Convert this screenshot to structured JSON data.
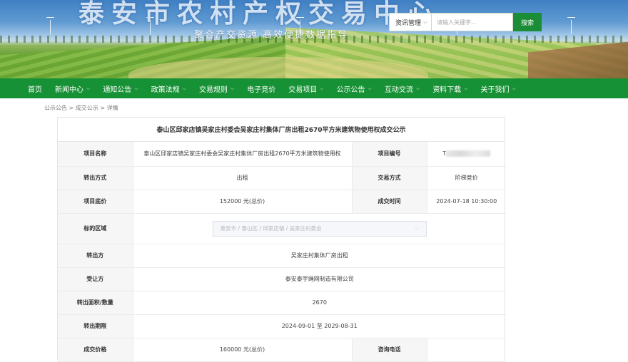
{
  "banner": {
    "title": "泰安市农村产权交易中心",
    "slogan": "聚合产交资源  高效便捷数据指导"
  },
  "search": {
    "category": "资讯管理",
    "placeholder": "请输入关键字...",
    "button": "搜索"
  },
  "nav": {
    "items": [
      {
        "label": "首页"
      },
      {
        "label": "新闻中心"
      },
      {
        "label": "通知公告"
      },
      {
        "label": "政策法规"
      },
      {
        "label": "交易规则"
      },
      {
        "label": "电子竞价"
      },
      {
        "label": "交易项目"
      },
      {
        "label": "公示公告"
      },
      {
        "label": "互动交流"
      },
      {
        "label": "资料下载"
      },
      {
        "label": "关于我们"
      }
    ]
  },
  "breadcrumb": "公示公告 > 成交公示 > 详情",
  "detail": {
    "title": "泰山区邱家店镇吴家庄村委会吴家庄村集体厂房出租2670平方米建筑物使用权成交公示",
    "labels": {
      "project_name": "项目名称",
      "project_no": "项目编号",
      "transfer_method": "转出方式",
      "trade_method": "交易方式",
      "listing_price": "项目底价",
      "deal_time": "成交时间",
      "region": "标的区域",
      "transferor": "转出方",
      "transferee": "受让方",
      "area": "转出面积/数量",
      "period": "转出期限",
      "deal_price": "成交价格",
      "phone": "咨询电话"
    },
    "values": {
      "project_name": "泰山区邱家店镇吴家庄村委会吴家庄村集体厂房出租2670平方米建筑物使用权",
      "project_no": "T",
      "transfer_method": "出租",
      "trade_method": "阶梯竞价",
      "listing_price": "152000 元(总价)",
      "deal_time": "2024-07-18 10:30:00",
      "region": "泰安市 / 泰山区 / 邱家店镇 / 吴家庄村委会",
      "transferor": "吴家庄村集体厂房出租",
      "transferee": "泰安泰宇绳网制造有限公司",
      "area": "2670",
      "period": "2024-09-01 至 2029-08-31",
      "deal_price": "160000 元(总价)",
      "phone": ""
    }
  },
  "colors": {
    "nav_green": "#179135",
    "button_green": "#1a8d36"
  }
}
